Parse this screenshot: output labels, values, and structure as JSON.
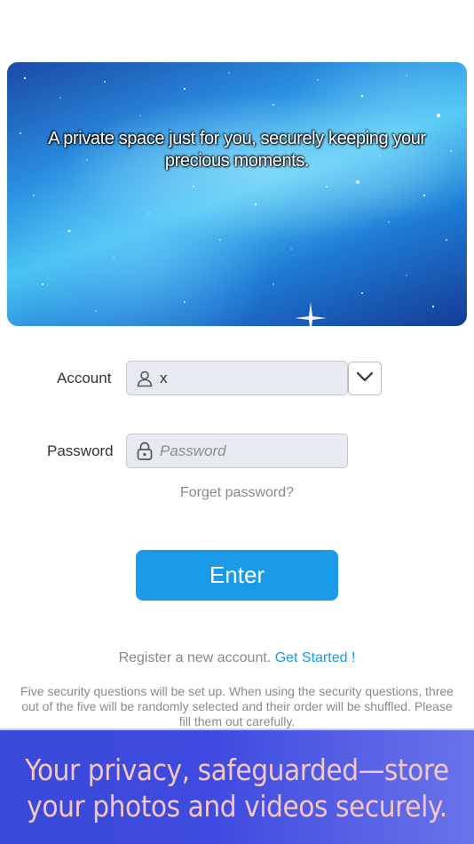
{
  "hero": {
    "tagline": "A private space just for you, securely keeping your precious moments."
  },
  "login": {
    "account_label": "Account",
    "account_value": "x",
    "account_icon": "user-icon",
    "dropdown_icon": "chevron-down-icon",
    "password_label": "Password",
    "password_placeholder": "Password",
    "password_icon": "lock-icon",
    "forget_link": "Forget password?",
    "enter_button": "Enter"
  },
  "register": {
    "prompt": "Register a new account.",
    "link": "Get Started !"
  },
  "notice": "Five security questions will be set up. When using the security questions, three out of the five will be randomly selected and their order will be shuffled. Please fill them out carefully.",
  "banner": {
    "text": "Your privacy, safeguarded—store your photos and videos securely."
  },
  "colors": {
    "accent": "#1a9ae8",
    "banner_bg": "#3f4be0",
    "banner_text": "#f4c7c2"
  }
}
